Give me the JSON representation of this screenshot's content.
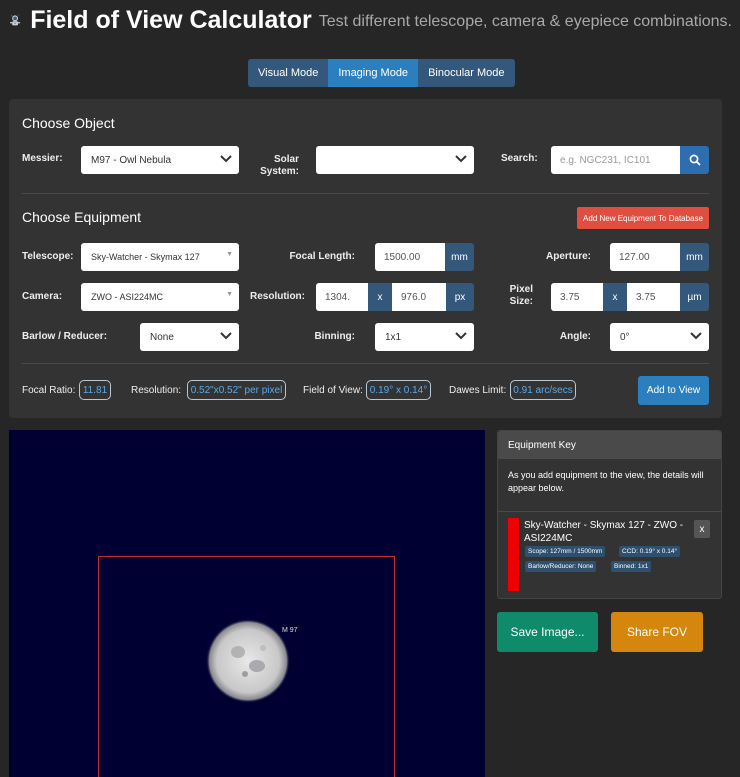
{
  "header": {
    "title": "Field of View Calculator",
    "subtitle": "Test different telescope, camera & eyepiece combinations."
  },
  "modes": [
    {
      "label": "Visual Mode",
      "active": false
    },
    {
      "label": "Imaging Mode",
      "active": true
    },
    {
      "label": "Binocular Mode",
      "active": false
    }
  ],
  "choose_object": {
    "title": "Choose Object",
    "messier_label": "Messier:",
    "messier_value": "M97 - Owl Nebula",
    "solar_label_line1": "Solar",
    "solar_label_line2": "System:",
    "solar_value": "",
    "search_label": "Search:",
    "search_placeholder": "e.g. NGC231, IC101"
  },
  "choose_equipment": {
    "title": "Choose Equipment",
    "add_new_label": "Add New Equipment To Database",
    "telescope_label": "Telescope:",
    "telescope_value": "Sky-Watcher - Skymax 127",
    "focal_length_label": "Focal Length:",
    "focal_length_value": "1500.00",
    "focal_length_unit": "mm",
    "aperture_label": "Aperture:",
    "aperture_value": "127.00",
    "aperture_unit": "mm",
    "camera_label": "Camera:",
    "camera_value": "ZWO - ASI224MC",
    "resolution_label": "Resolution:",
    "resolution_w": "1304.",
    "resolution_x": "x",
    "resolution_h": "976.0",
    "resolution_unit": "px",
    "pixel_label_line1": "Pixel",
    "pixel_label_line2": "Size:",
    "pixel_w": "3.75",
    "pixel_x": "x",
    "pixel_h": "3.75",
    "pixel_unit": "µm",
    "barlow_label": "Barlow / Reducer:",
    "barlow_value": "None",
    "binning_label": "Binning:",
    "binning_value": "1x1",
    "angle_label": "Angle:",
    "angle_value": "0°"
  },
  "results": {
    "focal_ratio_label": "Focal Ratio:",
    "focal_ratio_value": "11.81",
    "resolution_label": "Resolution:",
    "resolution_value": "0.52\"x0.52\" per pixel",
    "fov_label": "Field of View:",
    "fov_value": "0.19° x 0.14°",
    "dawes_label": "Dawes Limit:",
    "dawes_value": "0.91 arc/secs",
    "add_to_view_label": "Add to View"
  },
  "sky_view": {
    "object_label": "M 97"
  },
  "equipment_key": {
    "title": "Equipment Key",
    "description": "As you add equipment to the view, the details will appear below.",
    "item_name": "Sky-Watcher - Skymax 127 - ZWO - ASI224MC",
    "remove_label": "x",
    "tags": {
      "scope": "Scope: 127mm / 1500mm",
      "ccd": "CCD: 0.19° x 0.14°",
      "barlow": "Barlow/Reducer: None",
      "binned": "Binned: 1x1"
    },
    "item_color": "#ee0000"
  },
  "actions": {
    "save_image_label": "Save Image...",
    "share_fov_label": "Share FOV"
  },
  "colors": {
    "background": "#262626",
    "panel": "#333333",
    "primary_blue": "#2c7fbf",
    "addon_blue": "#34577c",
    "danger": "#e04e3f",
    "save_green": "#0f8a6a",
    "share_orange": "#d4860d",
    "sky": "#000033"
  }
}
